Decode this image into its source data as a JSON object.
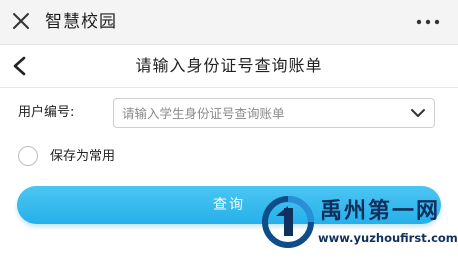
{
  "topbar": {
    "title": "智慧校园",
    "close_icon": "close-icon",
    "more_icon": "more-horizontal-icon"
  },
  "navbar": {
    "title": "请输入身份证号查询账单",
    "back_icon": "chevron-left-icon"
  },
  "form": {
    "user_id_label": "用户编号:",
    "user_id_placeholder": "请输入学生身份证号查询账单",
    "dropdown_icon": "chevron-down-icon"
  },
  "save_common": {
    "label": "保存为常用",
    "checked": false
  },
  "query_button": {
    "label": "查询",
    "color": "#2ab3ec"
  },
  "watermark": {
    "title": "禹州第一网",
    "url": "www.yuzhoufirst.com"
  }
}
